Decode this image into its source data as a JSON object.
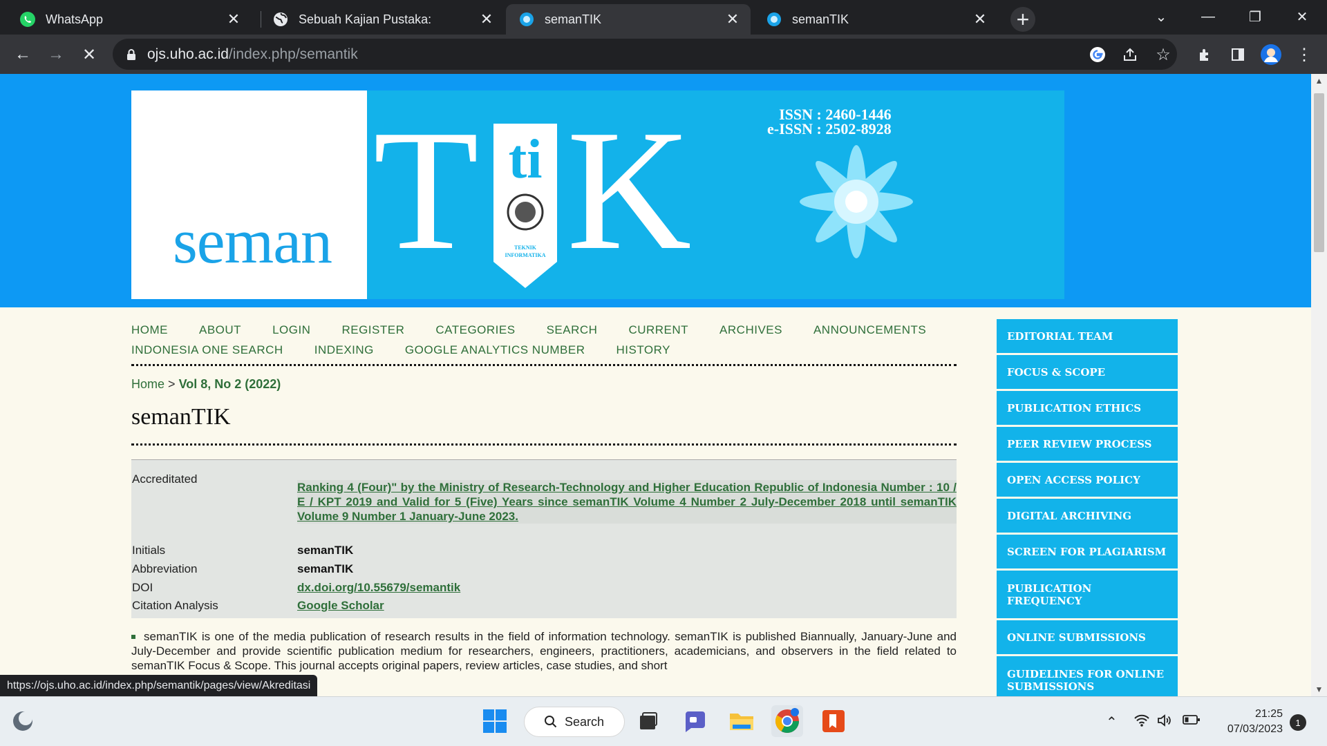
{
  "browser": {
    "tabs": [
      {
        "label": "WhatsApp",
        "favicon": "whatsapp-icon",
        "active": false
      },
      {
        "label": "Sebuah Kajian Pustaka:",
        "favicon": "globe-icon",
        "active": false
      },
      {
        "label": "semanTIK",
        "favicon": "semantik-favicon",
        "active": true
      },
      {
        "label": "semanTIK",
        "favicon": "semantik-favicon",
        "active": false
      }
    ],
    "url_host": "ojs.uho.ac.id",
    "url_path": "/index.php/semantik",
    "status_url": "https://ojs.uho.ac.id/index.php/semantik/pages/view/Akreditasi"
  },
  "banner": {
    "seman": "seman",
    "letter_t": "T",
    "letters_ti": "ti",
    "letter_k": "K",
    "issn": "ISSN : 2460-1446",
    "eissn": "e-ISSN : 2502-8928",
    "pennant_text_1": "TEKNIK",
    "pennant_text_2": "INFORMATIKA"
  },
  "nav": {
    "row1": [
      "HOME",
      "ABOUT",
      "LOGIN",
      "REGISTER",
      "CATEGORIES",
      "SEARCH",
      "CURRENT",
      "ARCHIVES",
      "ANNOUNCEMENTS"
    ],
    "row2": [
      "INDONESIA ONE SEARCH",
      "INDEXING",
      "GOOGLE ANALYTICS NUMBER",
      "HISTORY"
    ]
  },
  "breadcrumb": {
    "home": "Home",
    "sep": ">",
    "current": "Vol 8, No 2 (2022)"
  },
  "page_title": "semanTIK",
  "info": {
    "accredited_label": "Accreditated",
    "accredited_value": "Ranking 4 (Four)\" by the Ministry of Research-Technology and Higher Education Republic of Indonesia Number : 10 / E / KPT 2019 and Valid for 5 (Five) Years since semanTIK Volume 4 Number 2 July-December 2018 until semanTIK Volume 9 Number 1 January-June 2023.",
    "initials_label": "Initials",
    "initials_value": "semanTIK",
    "abbreviation_label": "Abbreviation",
    "abbreviation_value": "semanTIK",
    "doi_label": "DOI",
    "doi_value": "dx.doi.org/10.55679/semantik",
    "citation_label": "Citation Analysis",
    "citation_value": "Google Scholar"
  },
  "description": "semanTIK is one of the media publication of research results in the field of information technology. semanTIK is published Biannually, January-June and July-December and provide scientific publication medium for researchers, engineers, practitioners, academicians, and observers in the field related to semanTIK Focus & Scope. This journal accepts original papers, review articles, case studies, and short",
  "sidebar": [
    "EDITORIAL TEAM",
    "FOCUS & SCOPE",
    "PUBLICATION ETHICS",
    "PEER REVIEW PROCESS",
    "OPEN ACCESS POLICY",
    "DIGITAL ARCHIVING",
    "SCREEN FOR PLAGIARISM",
    "PUBLICATION FREQUENCY",
    "ONLINE SUBMISSIONS",
    "GUIDELINES FOR ONLINE SUBMISSIONS"
  ],
  "taskbar": {
    "search_label": "Search",
    "time": "21:25",
    "date": "07/03/2023",
    "notification_count": "1"
  },
  "colors": {
    "header_blue": "#0d99f4",
    "banner_cyan": "#13b2ea",
    "link_green": "#2f6f3a",
    "page_bg": "#fbf9ed"
  }
}
